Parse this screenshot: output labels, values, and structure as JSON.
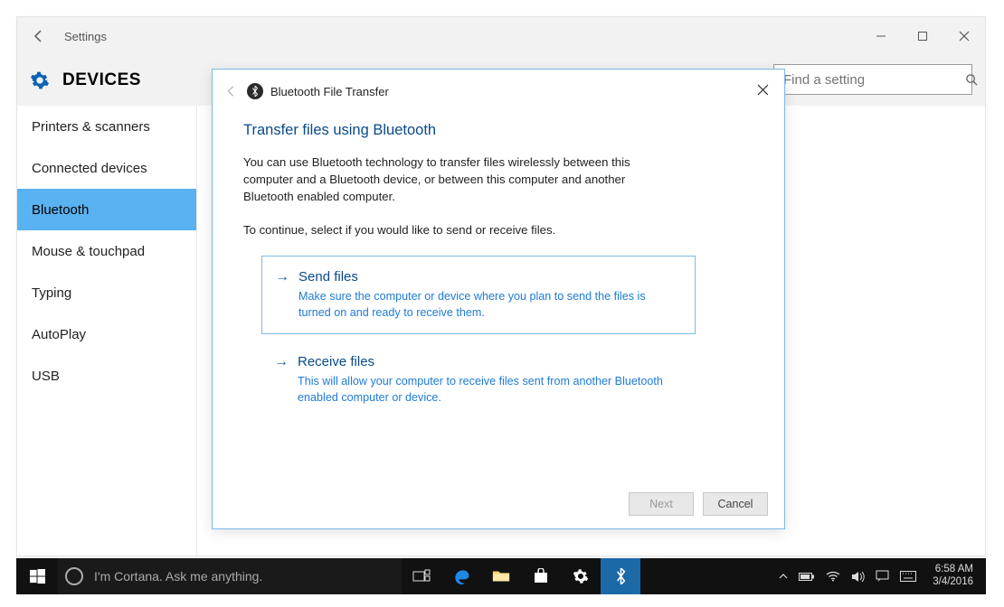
{
  "settings": {
    "window_title": "Settings",
    "heading": "DEVICES",
    "search_placeholder": "Find a setting",
    "sidebar": [
      "Printers & scanners",
      "Connected devices",
      "Bluetooth",
      "Mouse & touchpad",
      "Typing",
      "AutoPlay",
      "USB"
    ],
    "sidebar_selected": 2
  },
  "wizard": {
    "title": "Bluetooth File Transfer",
    "heading": "Transfer files using Bluetooth",
    "intro": "You can use Bluetooth technology to transfer files wirelessly between this computer and a Bluetooth device, or between this computer and another Bluetooth enabled computer.",
    "prompt": "To continue, select if you would like to send or receive files.",
    "options": [
      {
        "title": "Send files",
        "desc": "Make sure the computer or device where you plan to send the files is turned on and ready to receive them."
      },
      {
        "title": "Receive files",
        "desc": "This will allow your computer to receive files sent from another Bluetooth enabled computer or device."
      }
    ],
    "selected_option": 0,
    "next_label": "Next",
    "cancel_label": "Cancel"
  },
  "taskbar": {
    "cortana_placeholder": "I'm Cortana. Ask me anything.",
    "clock_time": "6:58 AM",
    "clock_date": "3/4/2016"
  }
}
